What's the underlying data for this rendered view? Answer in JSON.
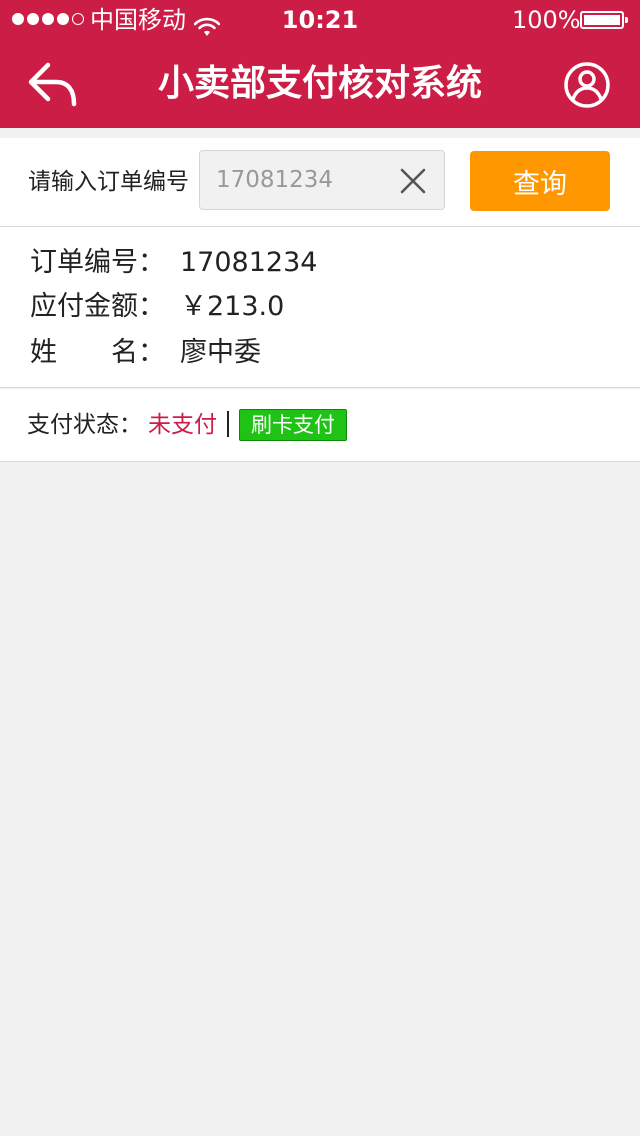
{
  "statusbar": {
    "carrier": "中国移动",
    "time": "10:21",
    "battery": "100%",
    "signal_bars_filled": 4,
    "signal_bars_total": 5,
    "battery_level": 1.0
  },
  "navbar": {
    "title": "小卖部支付核对系统",
    "back_icon": "reply-arrow-icon",
    "user_icon": "user-circle-icon"
  },
  "search": {
    "label": "请输入订单编号",
    "value": "17081234",
    "clear_icon": "close-icon",
    "button_label": "查询"
  },
  "order": {
    "order_no_label": "订单编号：",
    "order_no": "17081234",
    "amount_label": "应付金额：",
    "amount": "￥213.0",
    "name_label": "姓　　名：",
    "name": "廖中委"
  },
  "payment": {
    "status_label": "支付状态：",
    "status_value": "未支付",
    "card_pay_label": "刷卡支付"
  },
  "colors": {
    "brand": "#cc1d46",
    "query_button": "#ff9700",
    "pay_button": "#1fc316",
    "background": "#f1f1f1"
  }
}
